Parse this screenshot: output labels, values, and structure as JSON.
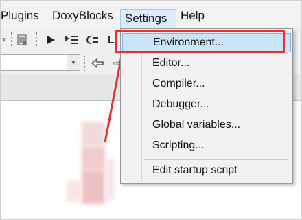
{
  "menubar": {
    "items": [
      "Plugins",
      "DoxyBlocks",
      "Settings",
      "Help"
    ],
    "active": "Settings"
  },
  "toolbar": {
    "icons": [
      "dropdown-arrow-icon",
      "build-settings-icon",
      "run-icon",
      "step-into-icon",
      "step-out-icon",
      "next-line-icon",
      "back-arrow-icon"
    ]
  },
  "settings_menu": {
    "items": [
      {
        "label": "Environment...",
        "highlighted": true
      },
      {
        "label": "Editor..."
      },
      {
        "label": "Compiler..."
      },
      {
        "label": "Debugger..."
      },
      {
        "label": "Global variables..."
      },
      {
        "label": "Scripting..."
      },
      {
        "label": "Edit startup script"
      }
    ]
  },
  "colors": {
    "annotation": "#e8312f",
    "highlight_fill": "#cce4f8",
    "highlight_border": "#7eb4ea",
    "menu_bg": "#f2f2f2"
  }
}
